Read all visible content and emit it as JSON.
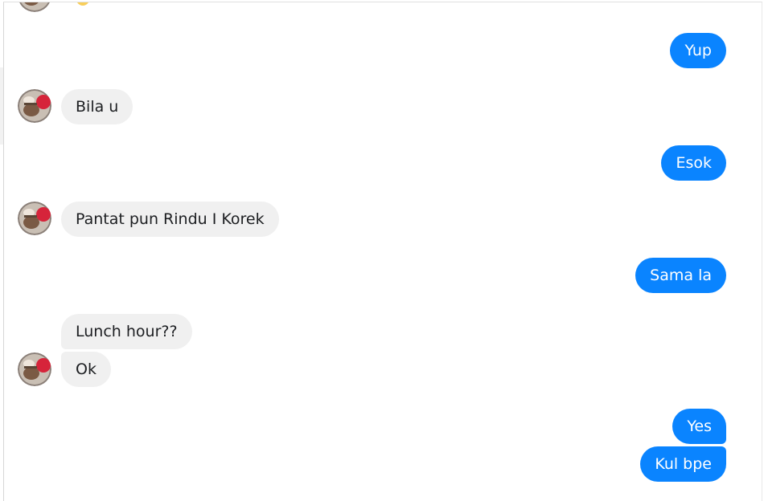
{
  "conversation": {
    "messages": [
      {
        "id": "m1",
        "from": "me",
        "text": "Yup"
      },
      {
        "id": "m2",
        "from": "contact",
        "text": "Bila u"
      },
      {
        "id": "m3",
        "from": "me",
        "text": "Esok"
      },
      {
        "id": "m4",
        "from": "contact",
        "text": "Pantat pun Rindu I Korek"
      },
      {
        "id": "m5",
        "from": "me",
        "text": "Sama la"
      },
      {
        "id": "m6",
        "from": "contact",
        "text": "Lunch hour??"
      },
      {
        "id": "m7",
        "from": "contact",
        "text": "Ok"
      },
      {
        "id": "m8",
        "from": "me",
        "text": "Yes"
      },
      {
        "id": "m9",
        "from": "me",
        "text": "Kul bpe"
      }
    ]
  },
  "colors": {
    "outgoing_bubble": "#0a84ff",
    "incoming_bubble": "#f0f0f0",
    "incoming_text": "#1c1e21",
    "outgoing_text": "#ffffff"
  },
  "icons": {
    "contact_avatar": "contact-avatar-icon"
  }
}
